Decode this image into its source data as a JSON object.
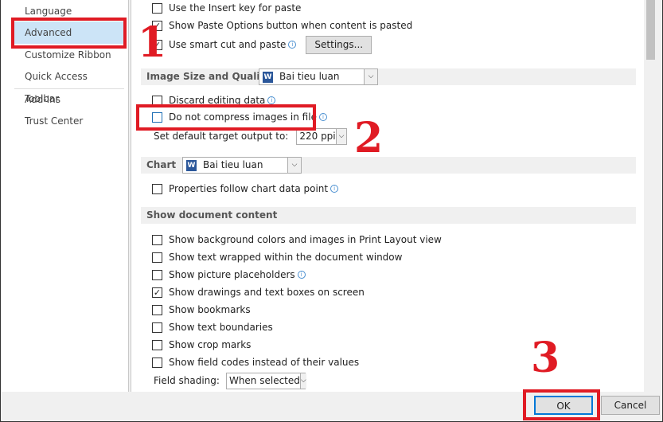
{
  "sidebar": {
    "items": [
      {
        "label": "Language"
      },
      {
        "label": "Advanced"
      },
      {
        "label": "Customize Ribbon"
      },
      {
        "label": "Quick Access Toolbar"
      },
      {
        "label": "Add-Ins"
      },
      {
        "label": "Trust Center"
      }
    ],
    "selected": "Advanced"
  },
  "paste": {
    "insert_key": {
      "label": "Use the Insert key for paste",
      "checked": false
    },
    "show_paste_options": {
      "label": "Show Paste Options button when content is pasted",
      "checked": true
    },
    "smart_cut": {
      "label": "Use smart cut and paste",
      "checked": true
    },
    "settings_button": "Settings..."
  },
  "image": {
    "header": "Image Size and Quality",
    "document": "Bai tieu luan",
    "discard": {
      "label": "Discard editing data",
      "checked": false
    },
    "no_compress": {
      "label": "Do not compress images in file",
      "checked": false
    },
    "target_label": "Set default target output to:",
    "target_value": "220 ppi"
  },
  "chart": {
    "header": "Chart",
    "document": "Bai tieu luan",
    "properties": {
      "label": "Properties follow chart data point",
      "checked": false
    }
  },
  "show": {
    "header": "Show document content",
    "items": [
      {
        "label": "Show background colors and images in Print Layout view",
        "checked": false
      },
      {
        "label": "Show text wrapped within the document window",
        "checked": false
      },
      {
        "label": "Show picture placeholders",
        "checked": false,
        "info": true
      },
      {
        "label": "Show drawings and text boxes on screen",
        "checked": true
      },
      {
        "label": "Show bookmarks",
        "checked": false
      },
      {
        "label": "Show text boundaries",
        "checked": false
      },
      {
        "label": "Show crop marks",
        "checked": false
      },
      {
        "label": "Show field codes instead of their values",
        "checked": false
      }
    ],
    "field_shading_label": "Field shading:",
    "field_shading_value": "When selected"
  },
  "footer": {
    "ok": "OK",
    "cancel": "Cancel"
  },
  "annotations": {
    "one": "1",
    "two": "2",
    "three": "3",
    "color": "#e01b24"
  },
  "icons": {
    "checkmark": "✓",
    "info": "i",
    "dropdown": "⌵",
    "word": "W"
  }
}
